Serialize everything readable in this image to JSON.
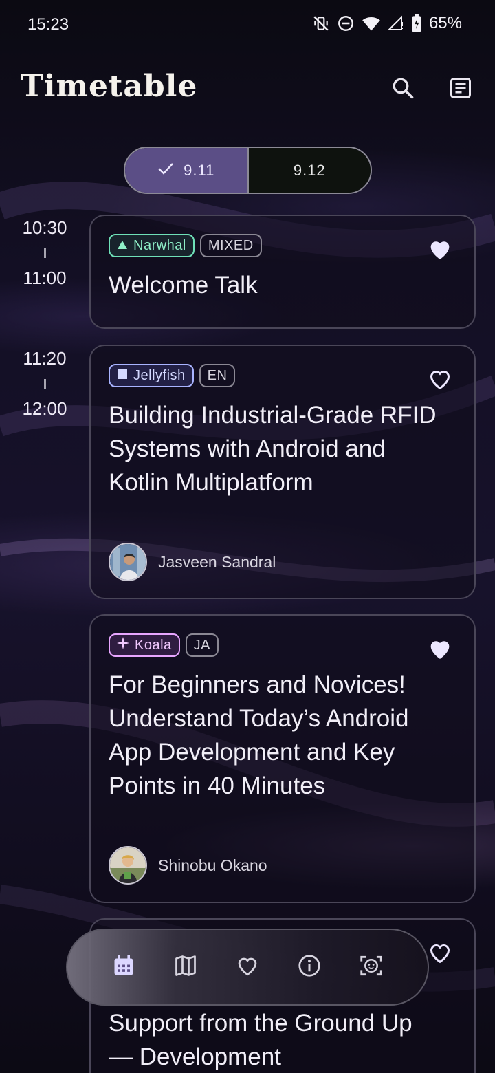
{
  "status_bar": {
    "time": "15:23",
    "battery": "65%"
  },
  "header": {
    "title": "Timetable"
  },
  "days": [
    {
      "label": "9.11",
      "selected": true
    },
    {
      "label": "9.12",
      "selected": false
    }
  ],
  "slots": [
    {
      "start": "10:30",
      "end": "11:00"
    },
    {
      "start": "11:20",
      "end": "12:00"
    }
  ],
  "sessions": [
    {
      "room": "Narwhal",
      "language": "MIXED",
      "title": "Welcome Talk",
      "favorited": true
    },
    {
      "room": "Jellyfish",
      "language": "EN",
      "title": "Building Industrial-Grade RFID Systems with Android and Kotlin Multiplatform",
      "speaker": "Jasveen Sandral",
      "favorited": false
    },
    {
      "room": "Koala",
      "language": "JA",
      "title": "For Beginners and Novices! Understand Today’s Android App Development and Key Points in 40 Minutes",
      "speaker": "Shinobu Okano",
      "favorited": true
    },
    {
      "title": "Support from the Ground Up — Development",
      "favorited": false
    }
  ],
  "bottom_nav": [
    "calendar",
    "map",
    "favorites",
    "info",
    "profile-card"
  ],
  "colors": {
    "accent": "#5b4e86",
    "narwhal": "#6fe0b8",
    "jellyfish": "#a9b4ff",
    "koala": "#e8a6ff"
  }
}
